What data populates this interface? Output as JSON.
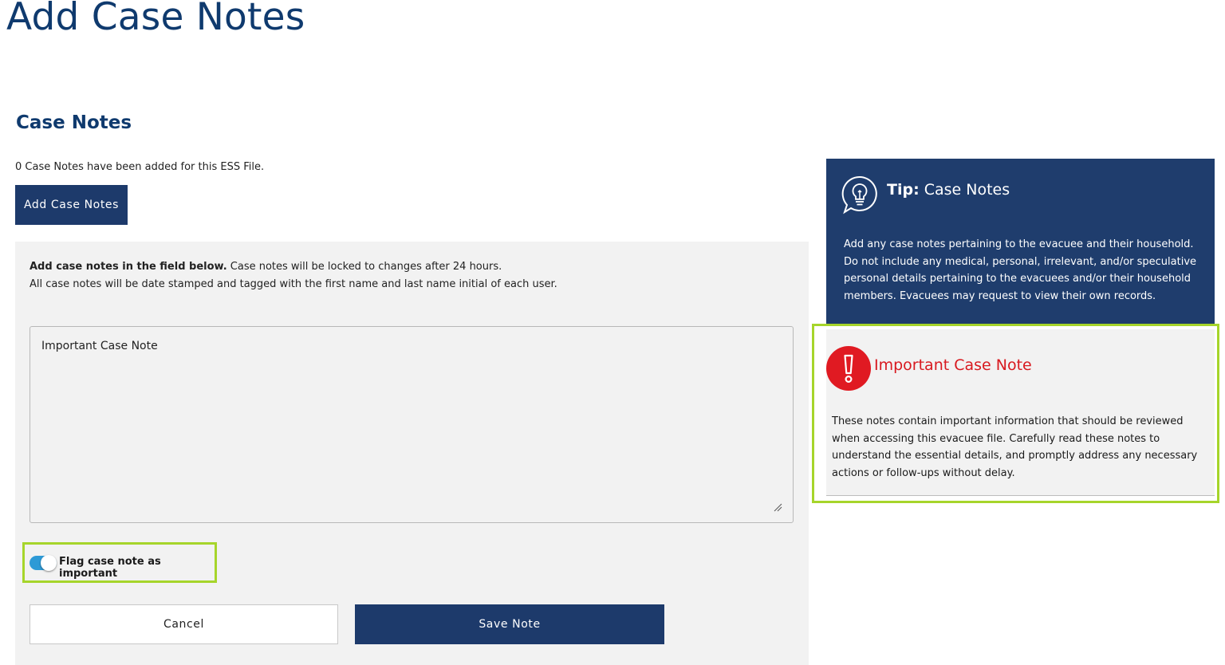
{
  "page": {
    "title": "Add Case Notes"
  },
  "case_notes": {
    "section_title": "Case Notes",
    "count_text": "0 Case Notes have been added for this ESS File.",
    "add_button_label": "Add Case Notes"
  },
  "form": {
    "instructions_bold": "Add case notes in the field below.",
    "instructions_rest": " Case notes will be locked to changes after 24 hours.",
    "instructions_line2": "All case notes will be date stamped and tagged with the first name and last name initial of each user.",
    "note_value": "Important Case Note",
    "flag_label": "Flag case note as important",
    "flag_checked": true,
    "cancel_label": "Cancel",
    "save_label": "Save Note"
  },
  "tip": {
    "icon": "lightbulb-icon",
    "title_bold": "Tip:",
    "title_rest": " Case Notes",
    "body": "Add any case notes pertaining to the evacuee and their household. Do not include any medical, personal, irrelevant, and/or speculative personal details pertaining to the evacuees and/or their household members. Evacuees may request to view their own records."
  },
  "important": {
    "icon": "exclamation-icon",
    "title": "Important Case Note",
    "body": "These notes contain important information that should be reviewed when accessing this evacuee file. Carefully read these notes to understand the essential details, and promptly address any necessary actions or follow-ups without delay."
  },
  "colors": {
    "navy": "#1d3a6b",
    "title_blue": "#0f3a6e",
    "highlight_green": "#a6d52b",
    "alert_red": "#d8191f",
    "toggle_blue": "#2d9ad6",
    "panel_gray": "#f2f2f2"
  }
}
